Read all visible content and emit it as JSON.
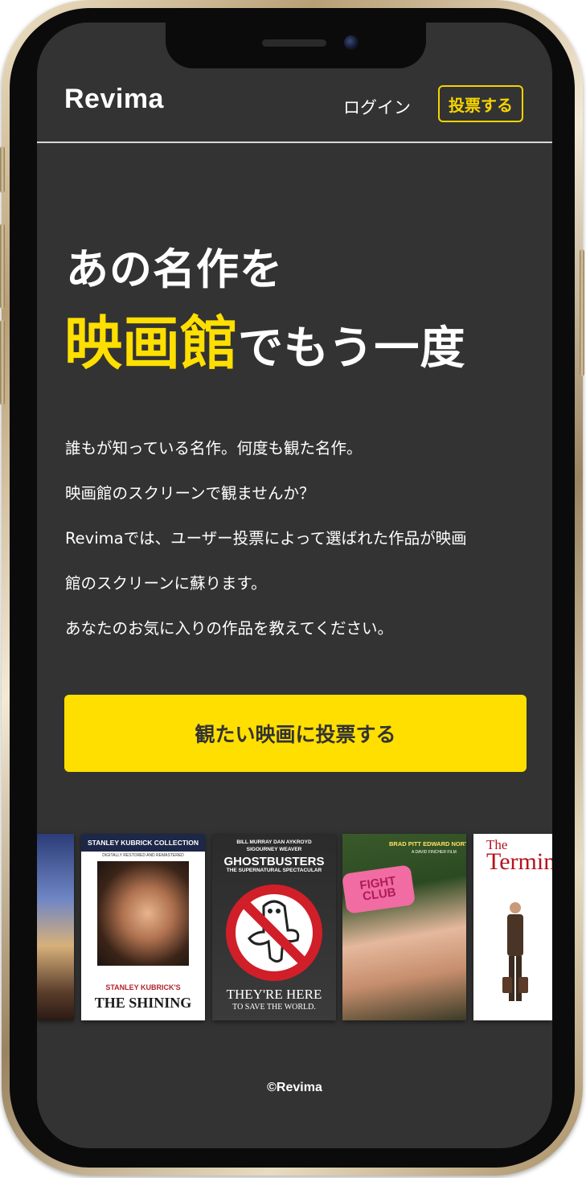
{
  "header": {
    "logo": "Revima",
    "login_label": "ログイン",
    "vote_label": "投票する"
  },
  "hero": {
    "line1": "あの名作を",
    "line2_accent": "映画館",
    "line2_rest": "でもう一度"
  },
  "description": [
    "誰もが知っている名作。何度も観た名作。",
    "映画館のスクリーンで観ませんか？",
    "Revimaでは、ユーザー投票によって選ばれた作品が映画",
    "館のスクリーンに蘇ります。",
    "あなたのお気に入りの作品を教えてください。"
  ],
  "cta": {
    "label": "観たい映画に投票する"
  },
  "posters": {
    "shining": {
      "banner": "STANLEY KUBRICK COLLECTION",
      "sub": "DIGITALLY RESTORED AND REMASTERED",
      "title_small": "STANLEY KUBRICK'S",
      "title": "THE SHINING"
    },
    "ghostbusters": {
      "cast_line1": "BILL MURRAY   DAN AYKROYD",
      "cast_line2": "SIGOURNEY WEAVER",
      "name": "GHOSTBUSTERS",
      "tag": "THE SUPERNATURAL SPECTACULAR",
      "bottom1": "THEY'RE HERE",
      "bottom2": "TO SAVE THE WORLD."
    },
    "fightclub": {
      "names": "BRAD PITT  EDWARD NORTON",
      "fincher": "A DAVID FINCHER FILM",
      "soap": "FIGHT CLUB"
    },
    "terminal": {
      "t1": "The",
      "t2": "Terminal"
    }
  },
  "footer": {
    "copyright": "©Revima"
  },
  "colors": {
    "background": "#333333",
    "accent": "#ffdf00",
    "text": "#ffffff"
  }
}
